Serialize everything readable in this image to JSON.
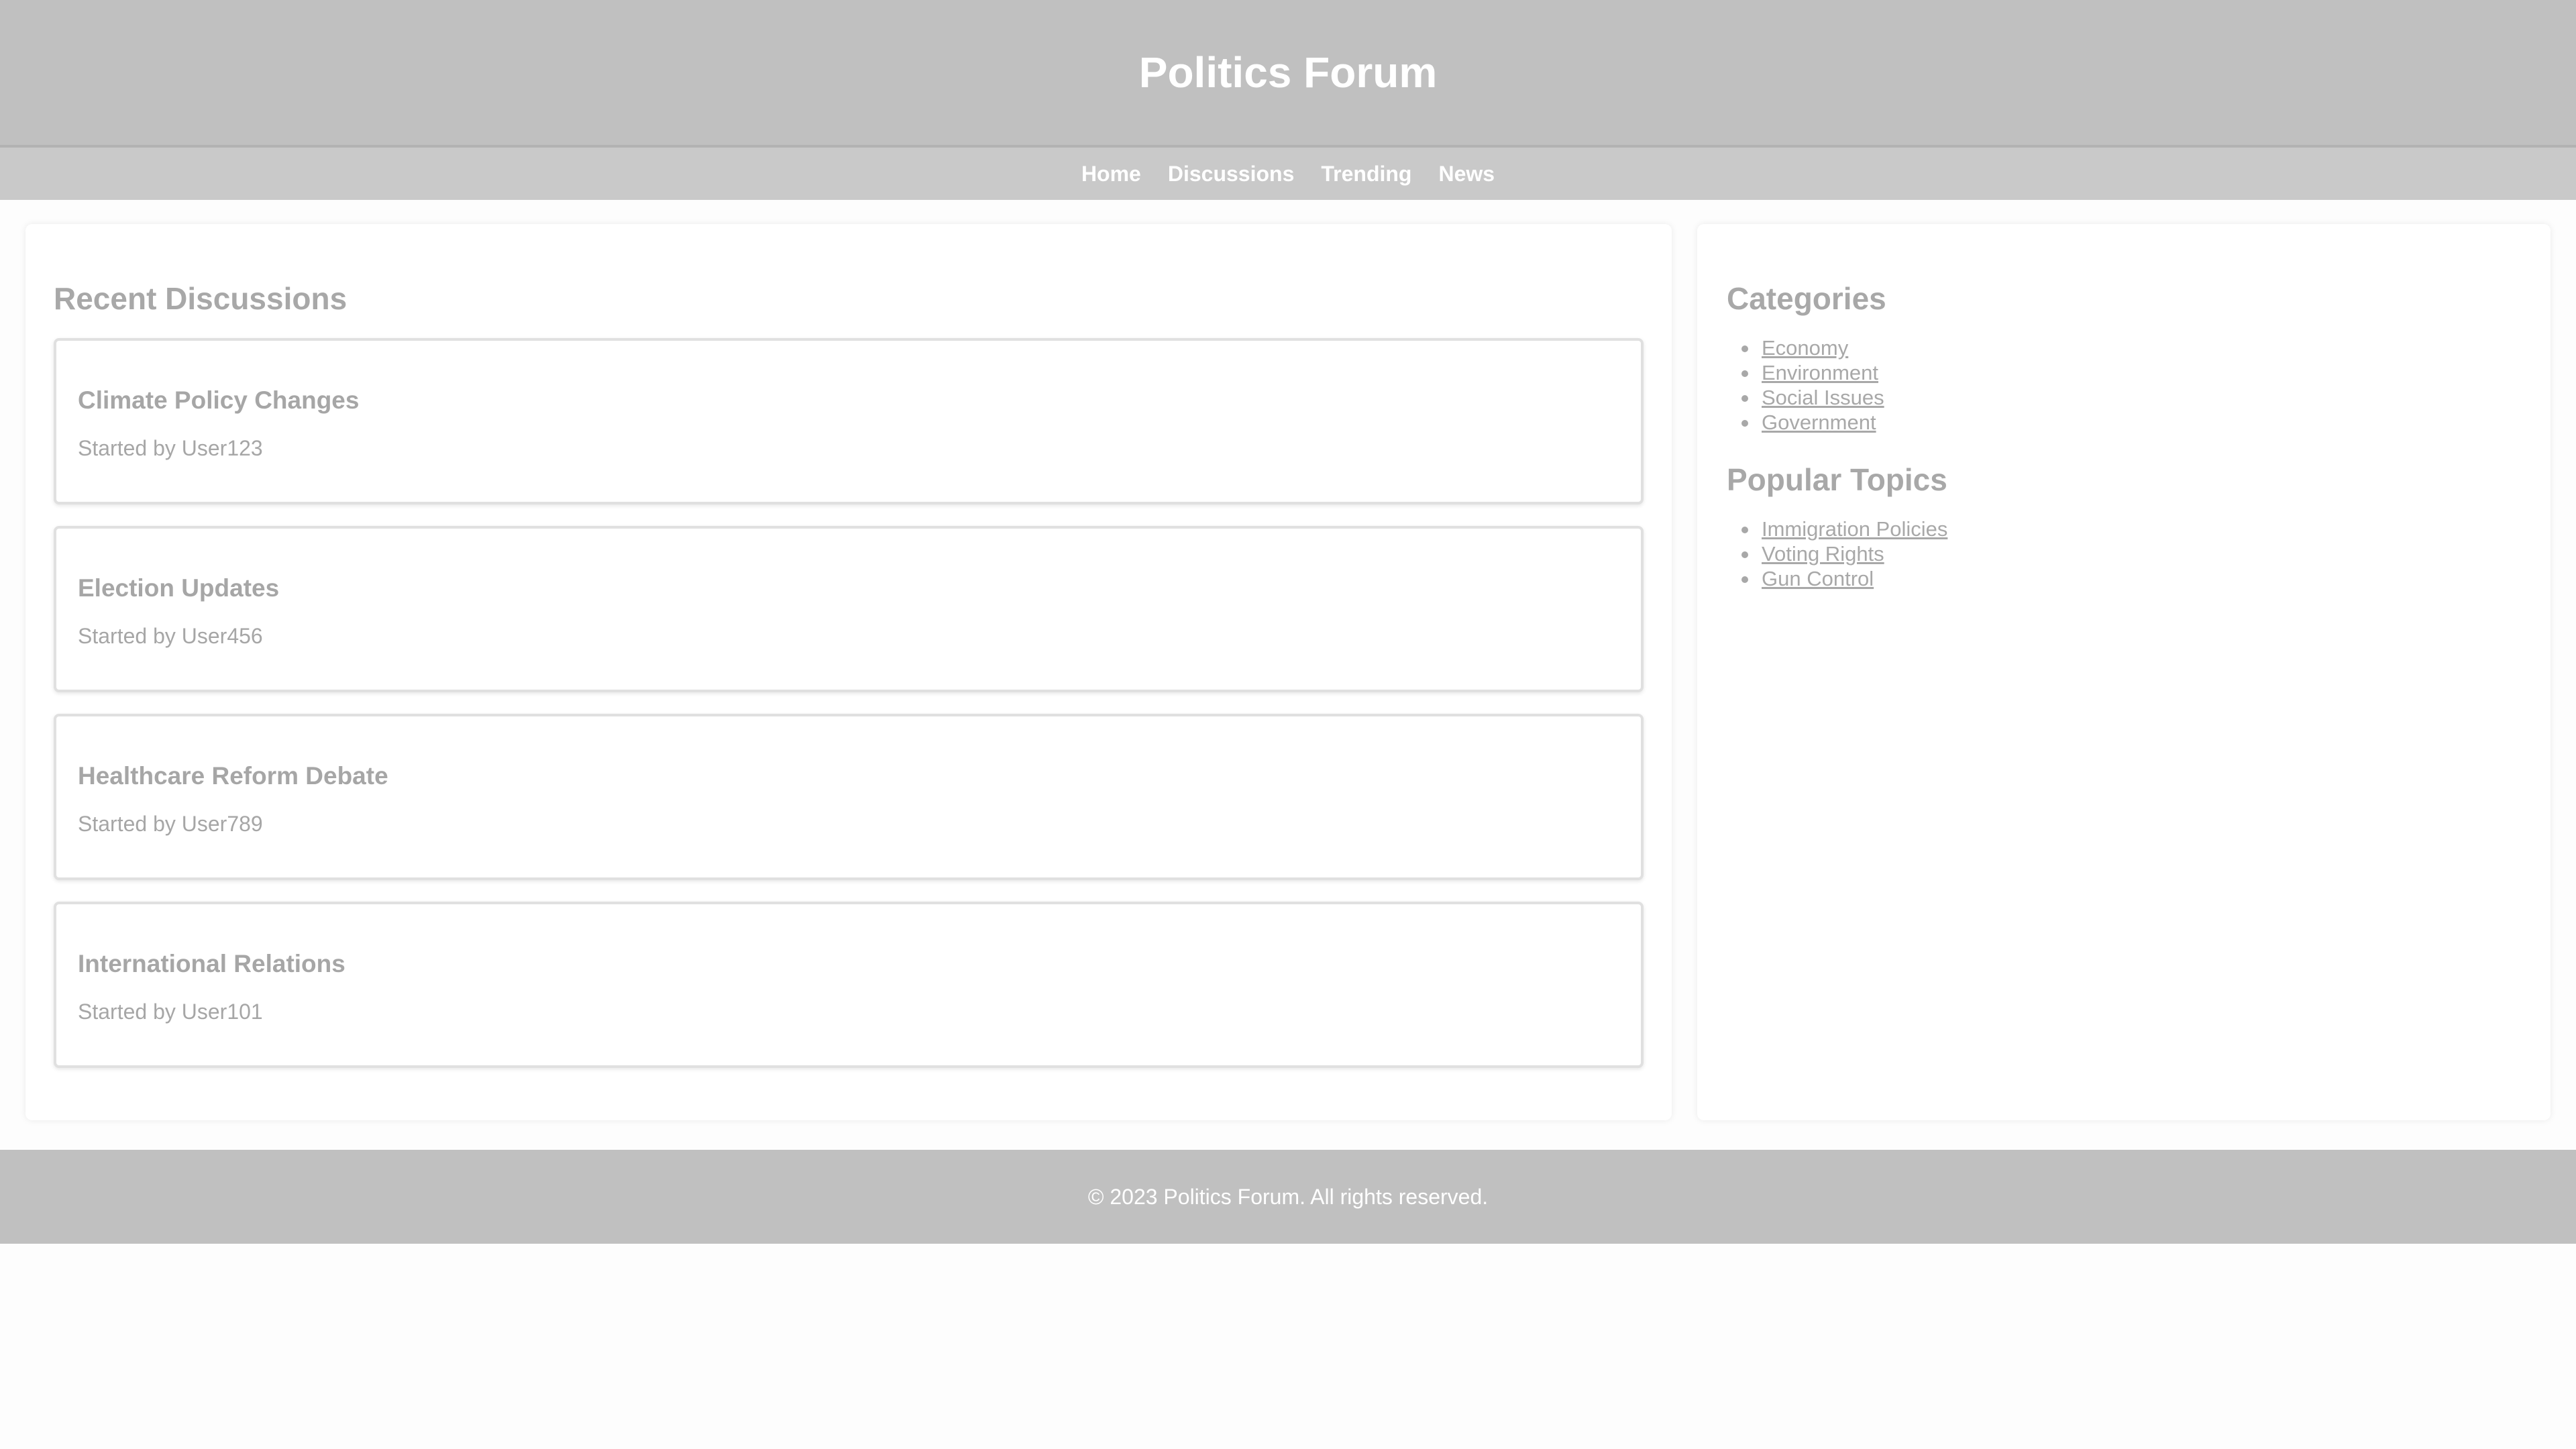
{
  "header": {
    "title": "Politics Forum"
  },
  "nav": {
    "items": [
      "Home",
      "Discussions",
      "Trending",
      "News"
    ]
  },
  "main": {
    "heading": "Recent Discussions",
    "discussions": [
      {
        "title": "Climate Policy Changes",
        "author": "Started by User123"
      },
      {
        "title": "Election Updates",
        "author": "Started by User456"
      },
      {
        "title": "Healthcare Reform Debate",
        "author": "Started by User789"
      },
      {
        "title": "International Relations",
        "author": "Started by User101"
      }
    ]
  },
  "sidebar": {
    "categories_heading": "Categories",
    "categories": [
      "Economy",
      "Environment",
      "Social Issues",
      "Government"
    ],
    "popular_heading": "Popular Topics",
    "popular": [
      "Immigration Policies",
      "Voting Rights",
      "Gun Control"
    ]
  },
  "footer": {
    "text": "© 2023 Politics Forum. All rights reserved."
  },
  "colors": {
    "header_bg": "#c0c0c0",
    "nav_bg": "#c9c9c9",
    "text_muted": "#a8a8a8",
    "header_text": "#ffffff"
  }
}
